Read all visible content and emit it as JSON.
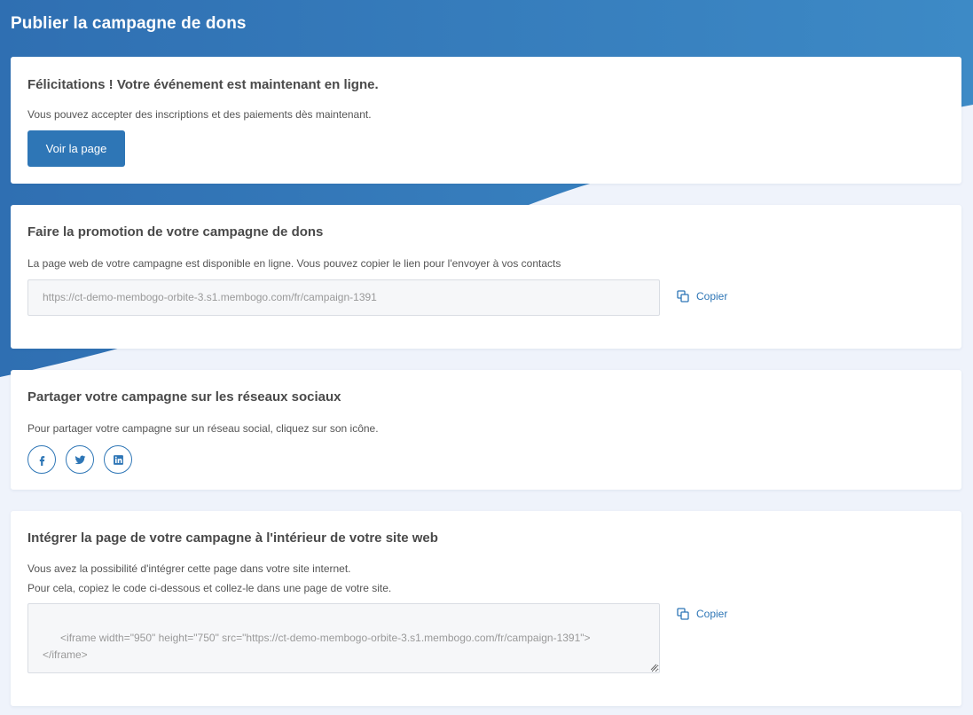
{
  "page": {
    "title": "Publier la campagne de dons"
  },
  "colors": {
    "accent": "#2e76b6",
    "header_gradient_start": "#2f6fb2",
    "header_gradient_end": "#3d8ac6",
    "background": "#eff3fb"
  },
  "online_card": {
    "heading": "Félicitations ! Votre événement est maintenant en ligne.",
    "text": "Vous pouvez accepter des inscriptions et des paiements dès maintenant.",
    "button_label": "Voir la page"
  },
  "promote_card": {
    "heading": "Faire la promotion de votre campagne de dons",
    "text": "La page web de votre campagne est disponible en ligne. Vous pouvez copier le lien pour l'envoyer à vos contacts",
    "url_value": "https://ct-demo-membogo-orbite-3.s1.membogo.com/fr/campaign-1391",
    "copy_label": "Copier",
    "copy_icon": "copy-icon"
  },
  "social_card": {
    "heading": "Partager votre campagne sur les réseaux sociaux",
    "text": "Pour partager votre campagne sur un réseau social, cliquez sur son icône.",
    "networks": [
      "facebook-icon",
      "twitter-icon",
      "linkedin-icon"
    ]
  },
  "embed_card": {
    "heading": "Intégrer la page de votre campagne à l'intérieur de votre site web",
    "text_line1": "Vous avez la possibilité d'intégrer cette page dans votre site internet.",
    "text_line2": "Pour cela, copiez le code ci-dessous et collez-le dans une page de votre site.",
    "embed_code": "<iframe width=\"950\" height=\"750\" src=\"https://ct-demo-membogo-orbite-3.s1.membogo.com/fr/campaign-1391\">\n</iframe>",
    "copy_label": "Copier",
    "copy_icon": "copy-icon"
  }
}
